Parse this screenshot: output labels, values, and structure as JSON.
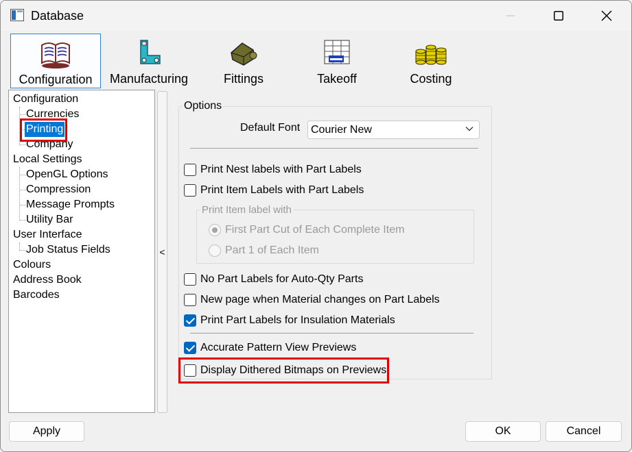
{
  "window": {
    "title": "Database"
  },
  "toolbar": {
    "items": [
      {
        "label": "Configuration",
        "icon": "configuration-book-icon",
        "active": true
      },
      {
        "label": "Manufacturing",
        "icon": "manufacturing-icon"
      },
      {
        "label": "Fittings",
        "icon": "fittings-icon"
      },
      {
        "label": "Takeoff",
        "icon": "takeoff-icon"
      },
      {
        "label": "Costing",
        "icon": "costing-coins-icon"
      }
    ]
  },
  "tree": {
    "items": [
      {
        "label": "Configuration",
        "level": 0
      },
      {
        "label": "Currencies",
        "level": 1
      },
      {
        "label": "Printing",
        "level": 1,
        "selected": true
      },
      {
        "label": "Company",
        "level": 1
      },
      {
        "label": "Local Settings",
        "level": 0
      },
      {
        "label": "OpenGL Options",
        "level": 1
      },
      {
        "label": "Compression",
        "level": 1
      },
      {
        "label": "Message Prompts",
        "level": 1
      },
      {
        "label": "Utility Bar",
        "level": 1
      },
      {
        "label": "User Interface",
        "level": 0
      },
      {
        "label": "Job Status Fields",
        "level": 1
      },
      {
        "label": "Colours",
        "level": 0
      },
      {
        "label": "Address Book",
        "level": 0
      },
      {
        "label": "Barcodes",
        "level": 0
      }
    ]
  },
  "splitter": {
    "label": "<"
  },
  "options": {
    "title": "Options",
    "default_font_label": "Default Font",
    "default_font_value": "Courier New",
    "checks": [
      {
        "label": "Print Nest labels with Part Labels",
        "checked": false
      },
      {
        "label": "Print Item Labels with Part Labels",
        "checked": false
      }
    ],
    "item_label_group": {
      "title": "Print Item label with",
      "radios": [
        {
          "label": "First Part Cut of Each Complete Item",
          "selected": true
        },
        {
          "label": "Part 1 of Each Item",
          "selected": false
        }
      ]
    },
    "checks2": [
      {
        "label": "No Part Labels for Auto-Qty Parts",
        "checked": false
      },
      {
        "label": "New page when Material changes on Part Labels",
        "checked": false
      },
      {
        "label": "Print Part Labels for Insulation Materials",
        "checked": true
      }
    ],
    "checks3": [
      {
        "label": "Accurate Pattern View Previews",
        "checked": true
      },
      {
        "label": "Display Dithered Bitmaps on Previews",
        "checked": false
      }
    ]
  },
  "buttons": {
    "apply": "Apply",
    "ok": "OK",
    "cancel": "Cancel"
  },
  "colors": {
    "accent": "#0067c0",
    "highlight": "#e00000",
    "selection": "#0078d7"
  }
}
